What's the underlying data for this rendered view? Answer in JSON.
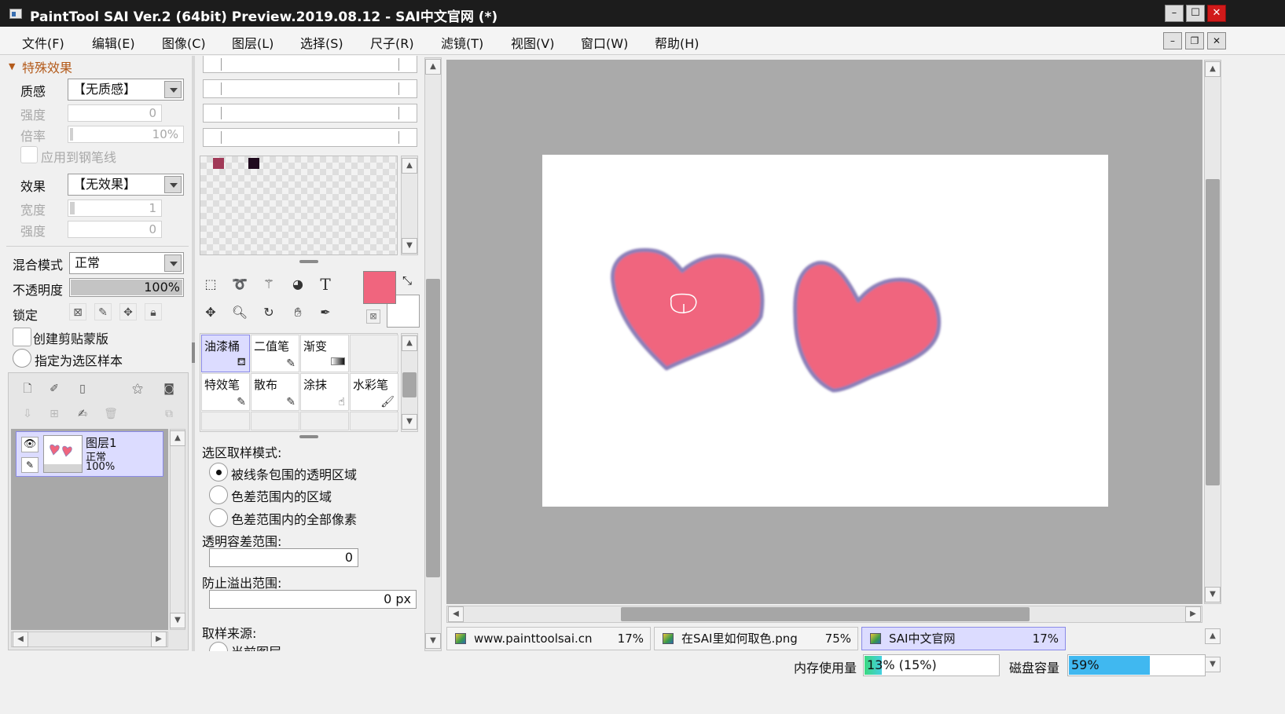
{
  "window": {
    "title": "PaintTool SAI Ver.2 (64bit) Preview.2019.08.12 - SAI中文官网 (*)",
    "minimize": "–",
    "maximize": "☐",
    "close": "✕"
  },
  "menu": [
    "文件(F)",
    "编辑(E)",
    "图像(C)",
    "图层(L)",
    "选择(S)",
    "尺子(R)",
    "滤镜(T)",
    "视图(V)",
    "窗口(W)",
    "帮助(H)"
  ],
  "special_effects": {
    "header": "特殊效果",
    "texture_label": "质感",
    "texture_value": "【无质感】",
    "strength_label": "强度",
    "strength_value": "0",
    "scale_label": "倍率",
    "scale_value": "10%",
    "apply_to_pen": "应用到钢笔线",
    "effect_label": "效果",
    "effect_value": "【无效果】",
    "width_label": "宽度",
    "width_value": "1",
    "effect_strength_label": "强度",
    "effect_strength_value": "0"
  },
  "layer_props": {
    "blend_label": "混合模式",
    "blend_value": "正常",
    "opacity_label": "不透明度",
    "opacity_value": "100%",
    "lock_label": "锁定",
    "clip_label": "创建剪贴蒙版",
    "sample_label": "指定为选区样本"
  },
  "layers": [
    {
      "name": "图层1",
      "mode": "正常",
      "opacity": "100%"
    }
  ],
  "colors": {
    "primary": "#f0657e",
    "secondary": "#ffffff",
    "swatch_1": "#a13a58",
    "swatch_2": "#200a1e",
    "stroke": "#8a7fb8",
    "accent_sel": "#dcdcff"
  },
  "tools": [
    "select-rect",
    "lasso",
    "magic-wand",
    "shape",
    "text",
    "move",
    "zoom",
    "rotate",
    "hand",
    "eyedropper"
  ],
  "text_tool_glyph": "T",
  "brushes": [
    {
      "name": "油漆桶",
      "icon": "bucket-icon"
    },
    {
      "name": "二值笔",
      "icon": "pen-icon"
    },
    {
      "name": "渐变",
      "icon": "gradient-icon"
    },
    {
      "name": "特效笔",
      "icon": "pen-icon"
    },
    {
      "name": "散布",
      "icon": "pen-icon"
    },
    {
      "name": "涂抹",
      "icon": "smudge-icon"
    },
    {
      "name": "水彩笔",
      "icon": "brush-icon"
    }
  ],
  "selection_options": {
    "mode_label": "选区取样模式:",
    "opt1": "被线条包围的透明区域",
    "opt2": "色差范围内的区域",
    "opt3": "色差范围内的全部像素",
    "tolerance_label": "透明容差范围:",
    "tolerance_value": "0",
    "overflow_label": "防止溢出范围:",
    "overflow_value": "0 px",
    "source_label": "取样来源:",
    "source_value": "当前图层"
  },
  "documents": [
    {
      "name": "www.painttoolsai.cn",
      "zoom": "17%"
    },
    {
      "name": "在SAI里如何取色.png",
      "zoom": "75%"
    },
    {
      "name": "SAI中文官网",
      "zoom": "17%"
    }
  ],
  "status": {
    "memory_label": "内存使用量",
    "memory_value": "13% (15%)",
    "memory_fraction": 0.13,
    "disk_label": "磁盘容量",
    "disk_value": "59%",
    "disk_fraction": 0.59
  }
}
